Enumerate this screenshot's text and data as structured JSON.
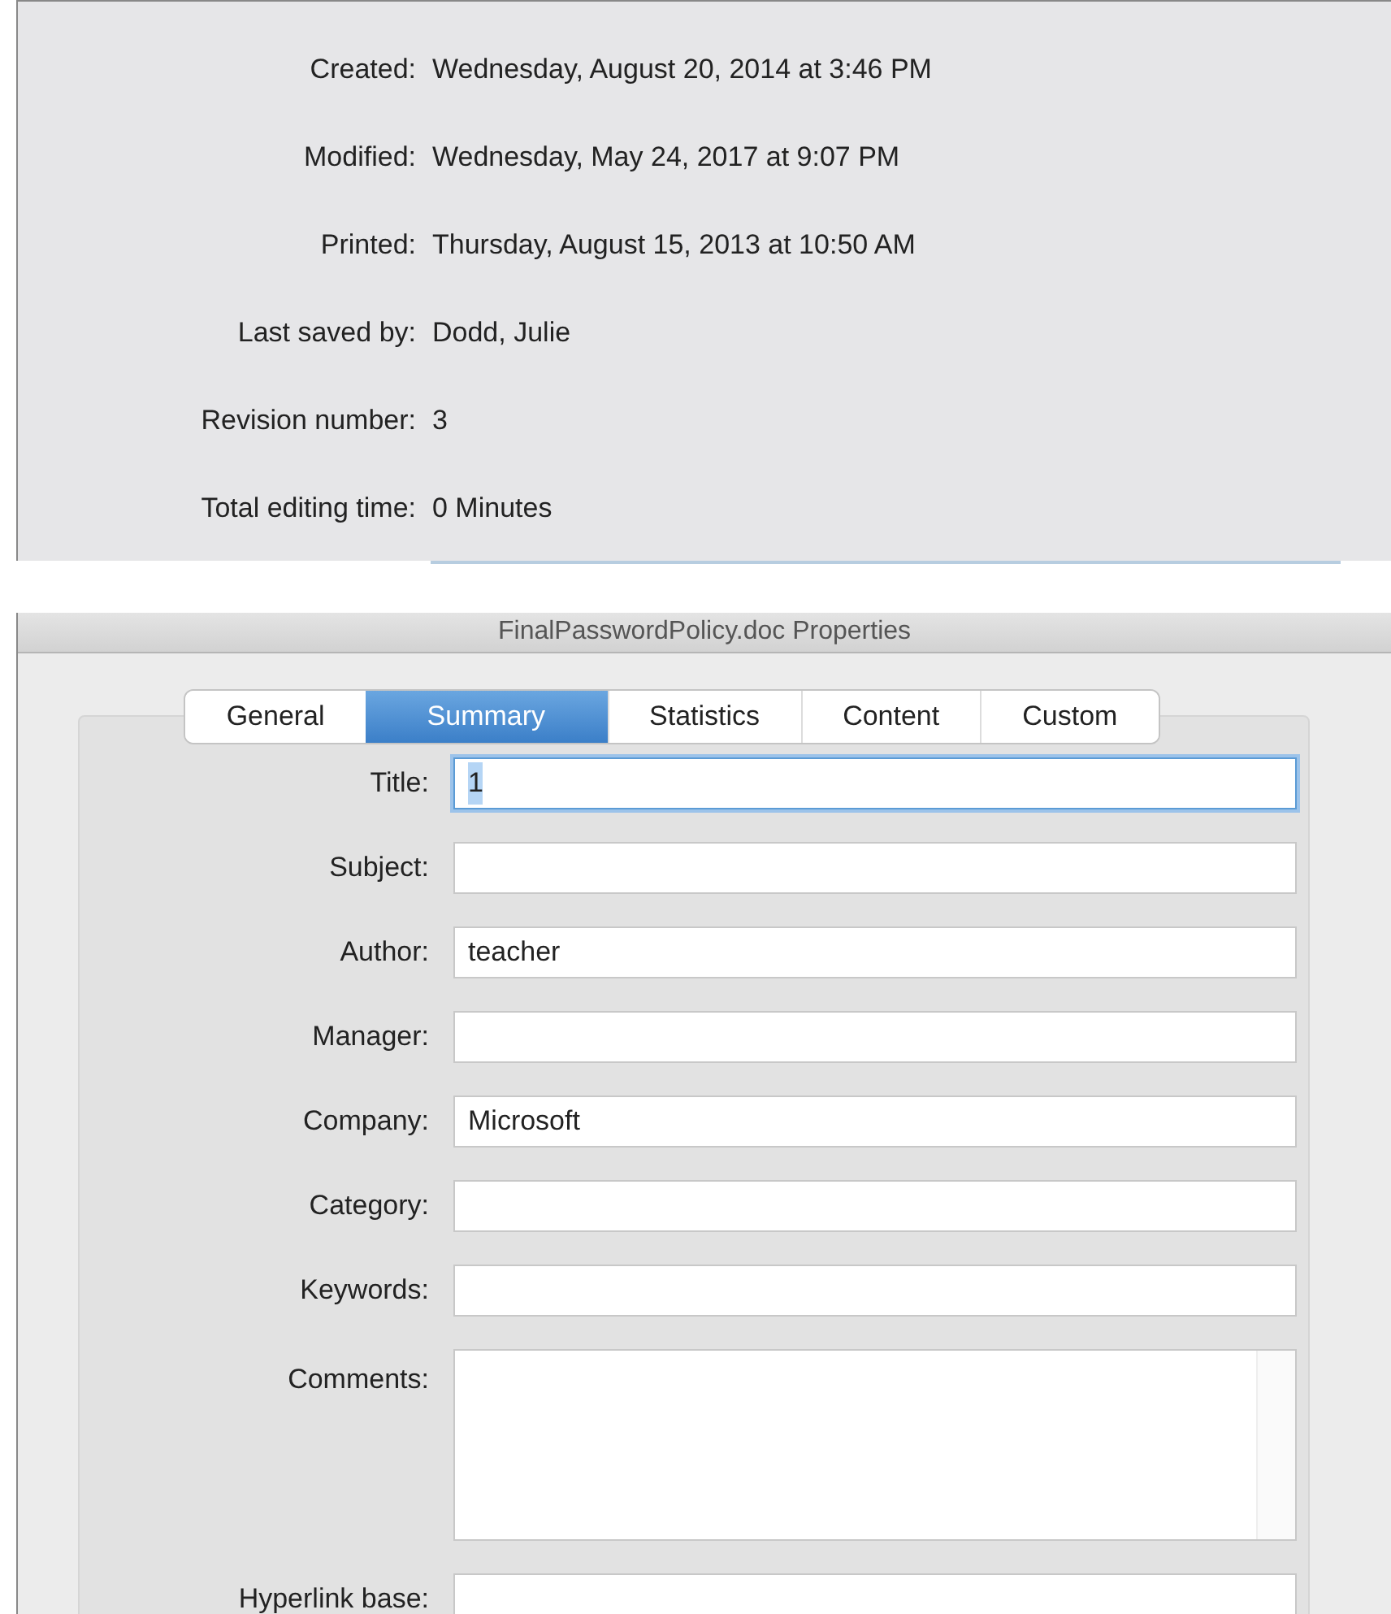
{
  "info_panel": {
    "rows": [
      {
        "label": "Created:",
        "value": "Wednesday, August 20, 2014 at 3:46 PM"
      },
      {
        "label": "Modified:",
        "value": "Wednesday, May 24, 2017 at 9:07 PM"
      },
      {
        "label": "Printed:",
        "value": "Thursday, August 15, 2013 at 10:50 AM"
      },
      {
        "label": "Last saved by:",
        "value": "Dodd, Julie"
      },
      {
        "label": "Revision number:",
        "value": "3"
      },
      {
        "label": "Total editing time:",
        "value": "0 Minutes"
      }
    ]
  },
  "window": {
    "title": "FinalPasswordPolicy.doc Properties"
  },
  "tabs": [
    {
      "label": "General",
      "selected": false
    },
    {
      "label": "Summary",
      "selected": true
    },
    {
      "label": "Statistics",
      "selected": false
    },
    {
      "label": "Content",
      "selected": false
    },
    {
      "label": "Custom",
      "selected": false
    }
  ],
  "fields": [
    {
      "label": "Title:",
      "kind": "line",
      "value": "1",
      "focused": true
    },
    {
      "label": "Subject:",
      "kind": "line",
      "focused": false
    },
    {
      "label": "Author:",
      "kind": "line",
      "value": "teacher",
      "focused": false
    },
    {
      "label": "Manager:",
      "kind": "line",
      "focused": false
    },
    {
      "label": "Company:",
      "kind": "line",
      "value": "Microsoft",
      "focused": false
    },
    {
      "label": "Category:",
      "kind": "line",
      "focused": false
    },
    {
      "label": "Keywords:",
      "kind": "line",
      "focused": false
    },
    {
      "label": "Comments:",
      "kind": "area",
      "focused": false
    },
    {
      "label": "Hyperlink base:",
      "kind": "line",
      "focused": false
    }
  ]
}
